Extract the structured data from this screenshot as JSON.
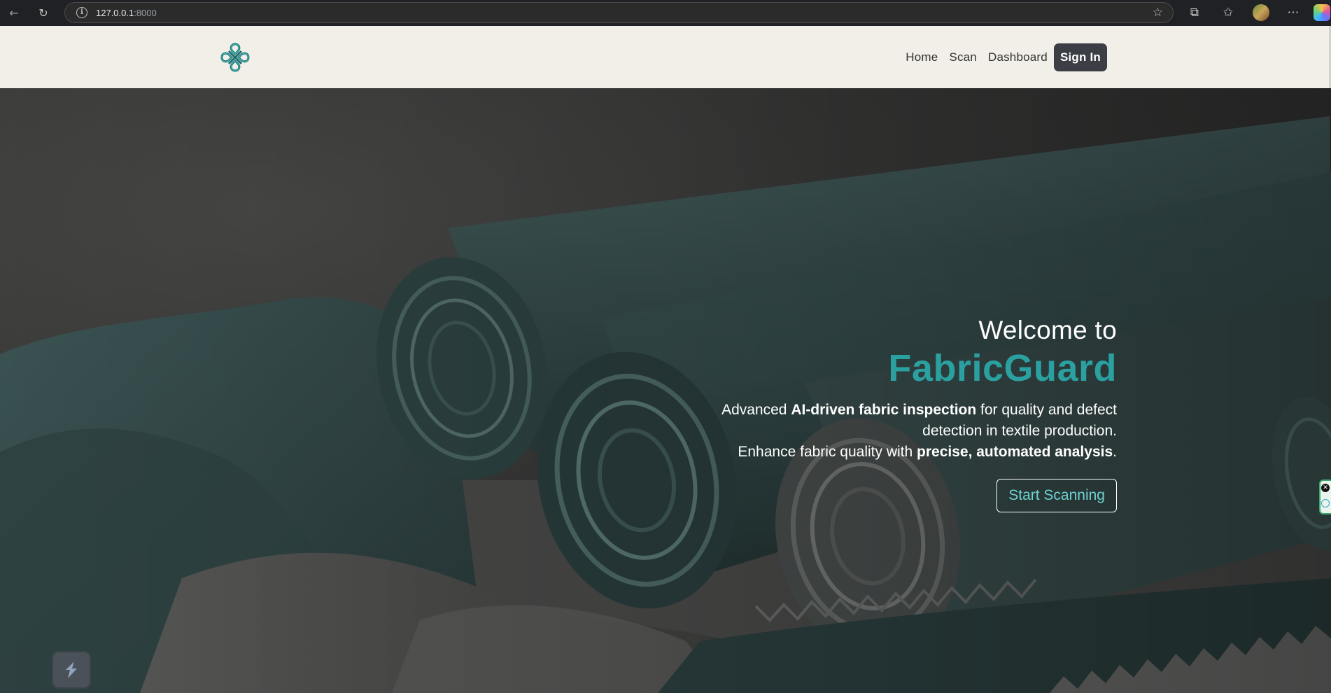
{
  "browser": {
    "url_host": "127.0.0.1",
    "url_port": ":8000",
    "icons": {
      "back": "arrow-left-icon",
      "reload": "reload-icon",
      "info": "info-icon",
      "bookmark": "star-icon",
      "extensions": "puzzle-icon",
      "favorites": "favorites-icon",
      "profile": "avatar",
      "more": "more-icon",
      "copilot": "copilot-icon"
    },
    "glyphs": {
      "back": "←",
      "reload": "↻",
      "info": "i",
      "star": "☆",
      "extensions": "⧉",
      "favorites": "✩",
      "more": "⋯"
    }
  },
  "nav": {
    "links": [
      "Home",
      "Scan",
      "Dashboard"
    ],
    "sign_in": "Sign In"
  },
  "hero": {
    "welcome": "Welcome to",
    "brand": "FabricGuard",
    "desc_line1_pre": "Advanced ",
    "desc_line1_bold": "AI-driven fabric inspection",
    "desc_line1_post": " for quality and defect",
    "desc_line2": "detection in textile production.",
    "desc_line3_pre": "Enhance fabric quality with ",
    "desc_line3_bold": "precise, automated analysis",
    "desc_line3_post": ".",
    "cta": "Start Scanning"
  },
  "colors": {
    "brand_teal": "#2ba0a0",
    "nav_bg": "#f2efe8",
    "signin_bg": "#3b3e44",
    "fabric": "#3f5656"
  }
}
